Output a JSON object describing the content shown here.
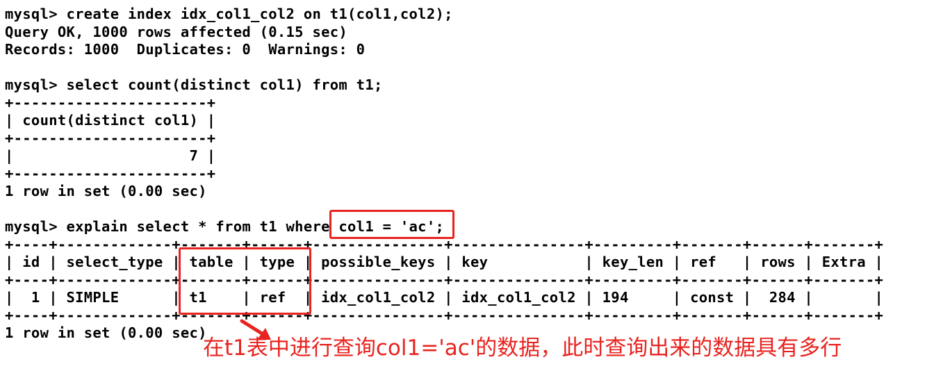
{
  "terminal": {
    "lines": [
      "mysql> create index idx_col1_col2 on t1(col1,col2);",
      "Query OK, 1000 rows affected (0.15 sec)",
      "Records: 1000  Duplicates: 0  Warnings: 0",
      "",
      "mysql> select count(distinct col1) from t1;",
      "+----------------------+",
      "| count(distinct col1) |",
      "+----------------------+",
      "|                    7 |",
      "+----------------------+",
      "1 row in set (0.00 sec)",
      "",
      "mysql> explain select * from t1 where col1 = 'ac';",
      "+----+-------------+-------+------+---------------+---------------+---------+-------+------+-------+",
      "| id | select_type | table | type | possible_keys | key           | key_len | ref   | rows | Extra |",
      "+----+-------------+-------+------+---------------+---------------+---------+-------+------+-------+",
      "|  1 | SIMPLE      | t1    | ref  | idx_col1_col2 | idx_col1_col2 | 194     | const |  284 |       |",
      "+----+-------------+-------+------+---------------+---------------+---------+-------+------+-------+",
      "1 row in set (0.00 sec)"
    ]
  },
  "annotation": {
    "text": "在t1表中进行查询col1='ac'的数据，此时查询出来的数据具有多行"
  },
  "colors": {
    "accent": "#e8231f",
    "text": "#000000",
    "background": "#ffffff"
  }
}
